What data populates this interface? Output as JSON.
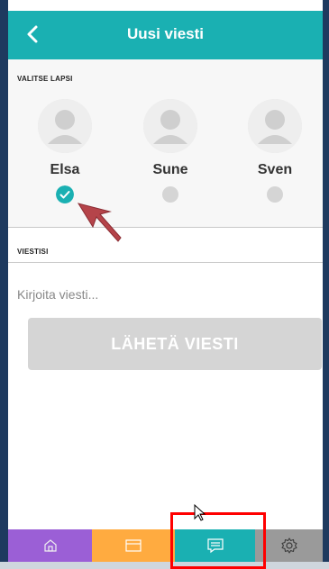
{
  "header": {
    "title": "Uusi viesti",
    "back_icon": "chevron-left-icon"
  },
  "child_section": {
    "label": "VALITSE LAPSI",
    "children": [
      {
        "name": "Elsa",
        "selected": true
      },
      {
        "name": "Sune",
        "selected": false
      },
      {
        "name": "Sven",
        "selected": false
      }
    ]
  },
  "message_section": {
    "label": "VIESTISI",
    "placeholder": "Kirjoita viesti...",
    "value": ""
  },
  "send_button": {
    "label": "LÄHETÄ VIESTI",
    "enabled": false
  },
  "tabbar": {
    "items": [
      {
        "icon": "home-icon",
        "color": "#9b5fd6"
      },
      {
        "icon": "calendar-icon",
        "color": "#ffab40"
      },
      {
        "icon": "message-icon",
        "color": "#1ab0b2",
        "active": true
      },
      {
        "icon": "gear-icon",
        "color": "#9a9a9a"
      }
    ]
  },
  "colors": {
    "accent": "#1ab0b2",
    "annotation": "#ff0000",
    "arrow": "#b5444a"
  }
}
